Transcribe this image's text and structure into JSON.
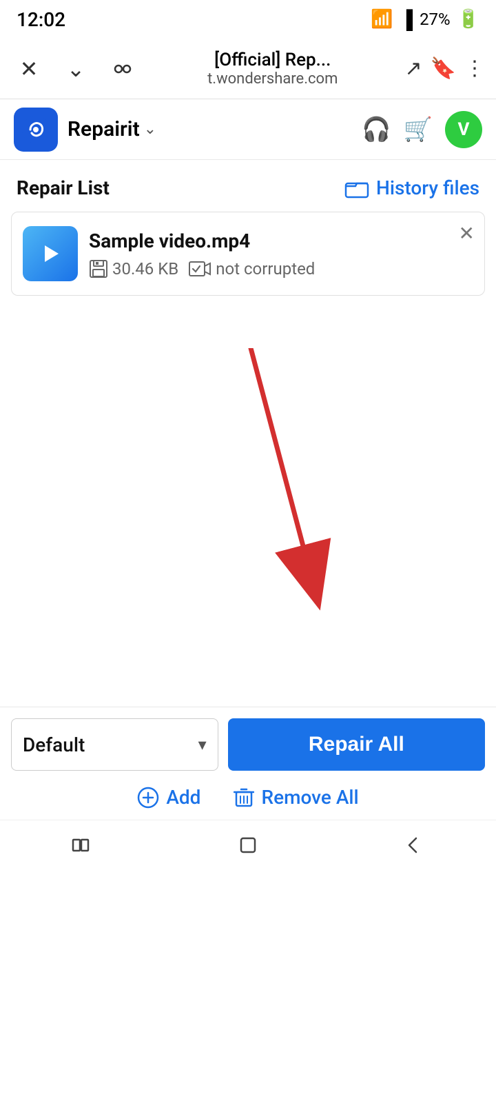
{
  "status_bar": {
    "time": "12:02",
    "battery": "27%"
  },
  "browser_bar": {
    "title": "[Official] Rep...",
    "domain": "t.wondershare.com"
  },
  "app_header": {
    "app_name": "Repairit",
    "avatar_letter": "V"
  },
  "repair_list": {
    "title": "Repair List",
    "history_files_label": "History files"
  },
  "file_card": {
    "file_name": "Sample video.mp4",
    "file_size": "30.46 KB",
    "status": "not corrupted"
  },
  "toolbar": {
    "default_label": "Default",
    "repair_all_label": "Repair All",
    "add_label": "Add",
    "remove_all_label": "Remove All"
  }
}
